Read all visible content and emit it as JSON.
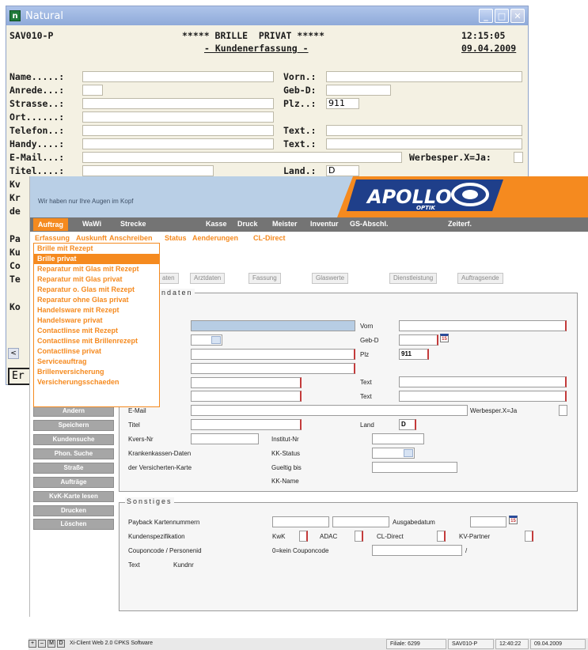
{
  "terminal": {
    "title": "Natural",
    "window_buttons": [
      "_",
      "□",
      "✕"
    ],
    "program": "SAV010-P",
    "heading": "***** BRILLE  PRIVAT *****",
    "subheading": "- Kundenerfassung -",
    "time": "12:15:05",
    "date": "09.04.2009",
    "labels": {
      "name": "Name.....:",
      "anrede": "Anrede...:",
      "strasse": "Strasse..:",
      "ort": "Ort......:",
      "telefon": "Telefon..:",
      "handy": "Handy....:",
      "email": "E-Mail...:",
      "titel": "Titel....:",
      "vorn": "Vorn.:",
      "gebd": "Geb-D:",
      "plz": "Plz..:",
      "text1": "Text.:",
      "text2": "Text.:",
      "werbe": "Werbesper.X=Ja:",
      "land": "Land.:"
    },
    "values": {
      "plz": "911",
      "land": "D"
    },
    "hidden_left": [
      "Kv",
      "Kr",
      "de",
      "Pa",
      "Ku",
      "Co",
      "Te",
      "Ko"
    ],
    "scroll_glyph": "<",
    "bottom_button": "Er"
  },
  "web": {
    "slogan": "Wir haben nur Ihre Augen im Kopf",
    "logo": {
      "brand": "APOLLO",
      "sub": "OPTIK"
    },
    "menu": [
      "Auftrag",
      "WaWi",
      "Strecke",
      "Kasse",
      "Druck",
      "Meister",
      "Inventur",
      "GS-Abschl.",
      "Zeiterf."
    ],
    "submenu": [
      "Erfassung",
      "Auskunft",
      "Anschreiben",
      "Status",
      "Aenderungen",
      "CL-Direct"
    ],
    "dropdown": [
      "Brille mit Rezept",
      "Brille privat",
      "Reparatur mit Glas mit Rezept",
      "Reparatur mit Glas privat",
      "Reparatur o. Glas mit Rezept",
      "Reparatur ohne Glas privat",
      "Handelsware mit Rezept",
      "Handelsware privat",
      "Contactlinse mit Rezept",
      "Contactlinse mit Brillenrezept",
      "Contactlinse privat",
      "Serviceauftrag",
      "Brillenversicherung",
      "Versicherungsschaeden"
    ],
    "tabs": [
      "aten",
      "Arztdaten",
      "Fassung",
      "Glaswerte",
      "Dienstleistung",
      "Auftragsende"
    ],
    "group1_title": "ndaten",
    "labels": {
      "vorn": "Vorn",
      "gebd": "Geb-D",
      "plz": "Plz",
      "text1": "Text",
      "text2": "Text",
      "email": "E-Mail",
      "werbe": "Werbesper.X=Ja",
      "titel": "Titel",
      "land": "Land",
      "kvers": "Kvers-Nr",
      "institut": "Institut-Nr",
      "kkdaten": "Krankenkassen-Daten",
      "kkstatus": "KK-Status",
      "versdaten": "der Versicherten-Karte",
      "gueltig": "Gueltig bis",
      "kkname": "KK-Name"
    },
    "values": {
      "plz": "911",
      "land": "D",
      "cal_glyph": "15"
    },
    "side_buttons": [
      "Andern",
      "Speichern",
      "Kundensuche",
      "Phon. Suche",
      "Straße",
      "Aufträge",
      "KvK-Karte lesen",
      "Drucken",
      "Löschen"
    ],
    "group2_title": "Sonstiges",
    "sonst": {
      "payback": "Payback Kartennummern",
      "ausgabe": "Ausgabedatum",
      "kundenspez": "Kundenspezifikation",
      "kwk": "KwK",
      "adac": "ADAC",
      "cldirect": "CL-Direct",
      "kvpartner": "KV-Partner",
      "coupon": "Couponcode / Personenid",
      "kein": "0=kein Couponcode",
      "slash": "/",
      "text": "Text",
      "kundnr": "Kundnr"
    }
  },
  "statusbar": {
    "icons": [
      "+",
      "–",
      "M",
      "D"
    ],
    "app": "Xi-Client Web 2.0 ©PKS Software",
    "filiale": "Filiale: 6299",
    "program": "SAV010-P",
    "time": "12:40:22",
    "date": "09.04.2009"
  }
}
